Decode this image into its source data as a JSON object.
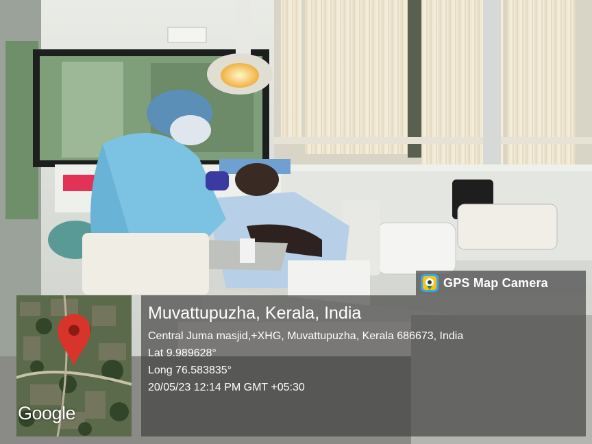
{
  "watermark": {
    "app_name": "GPS Map Camera",
    "icon": "camera-pin-icon"
  },
  "map": {
    "provider_logo": "Google",
    "marker_icon": "map-pin-icon",
    "marker_color": "#d9342b"
  },
  "location": {
    "place": "Muvattupuzha, Kerala, India",
    "address": "Central Juma masjid,+XHG, Muvattupuzha, Kerala 686673, India",
    "latitude": "Lat 9.989628°",
    "longitude": "Long 76.583835°",
    "timestamp": "20/05/23 12:14 PM GMT +05:30"
  }
}
